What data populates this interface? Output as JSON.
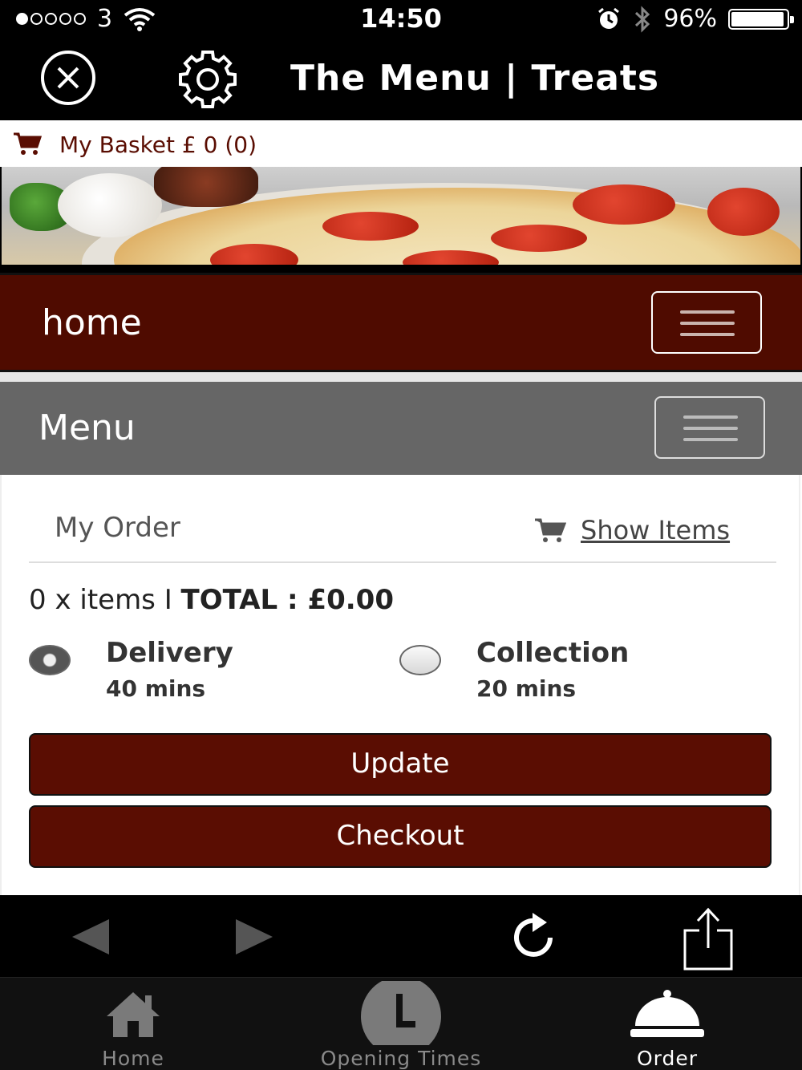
{
  "status_bar": {
    "carrier": "3",
    "time": "14:50",
    "battery": "96%",
    "battery_level": 0.96,
    "signal_dots_filled": 1,
    "signal_dots_total": 5
  },
  "header": {
    "title": "The Menu | Treats",
    "close_icon": "close-circle-icon",
    "settings_icon": "gear-icon"
  },
  "basket": {
    "label": "My Basket £ 0 (0)",
    "icon": "cart-icon"
  },
  "nav": {
    "home_label": "home",
    "menu_label": "Menu"
  },
  "order": {
    "title": "My Order",
    "show_items": "Show Items",
    "items_count": "0 x items I",
    "total": "TOTAL : £0.00",
    "options": [
      {
        "name": "Delivery",
        "time": "40 mins",
        "selected": true
      },
      {
        "name": "Collection",
        "time": "20 mins",
        "selected": false
      }
    ],
    "update_label": "Update",
    "checkout_label": "Checkout"
  },
  "browser_toolbar": {
    "icons": [
      "back-arrow-icon",
      "forward-arrow-icon",
      "reload-icon",
      "share-icon"
    ]
  },
  "tabs": [
    {
      "label": "Home",
      "icon": "house-icon",
      "active": false
    },
    {
      "label": "Opening Times",
      "icon": "clock-icon",
      "active": false
    },
    {
      "label": "Order",
      "icon": "service-bell-icon",
      "active": true
    }
  ],
  "colors": {
    "brand_maroon": "#4f0b00",
    "button_maroon": "#5a0d02",
    "menu_grey": "#666666"
  }
}
